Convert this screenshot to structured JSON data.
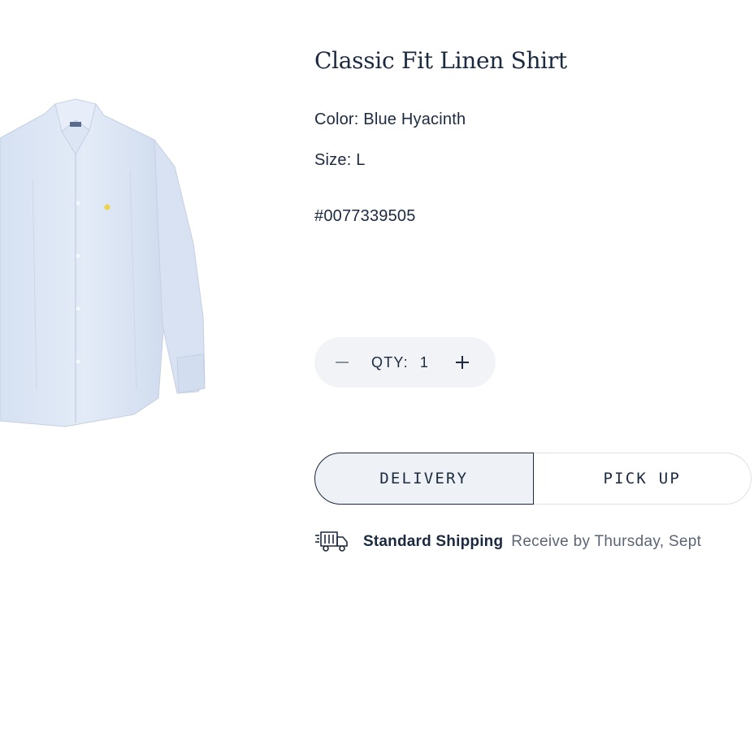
{
  "product": {
    "title": "Classic Fit Linen Shirt",
    "color_line": "Color: Blue Hyacinth",
    "size_line": "Size: L",
    "sku": "#0077339505",
    "image_icon": "blue-shirt-image"
  },
  "quantity": {
    "label": "QTY:",
    "value": "1",
    "decrement_icon": "minus-icon",
    "increment_icon": "plus-icon"
  },
  "fulfillment": {
    "options": [
      {
        "label": "DELIVERY",
        "selected": true
      },
      {
        "label": "PICK UP",
        "selected": false
      }
    ]
  },
  "shipping": {
    "icon": "delivery-truck-icon",
    "method": "Standard Shipping",
    "eta": "Receive by Thursday, Sept"
  },
  "colors": {
    "text": "#1c2a3f",
    "muted_text": "#5b6573",
    "pill_bg": "#f1f3f6",
    "selected_bg": "#eef1f5",
    "shirt": "#dce6f5"
  }
}
